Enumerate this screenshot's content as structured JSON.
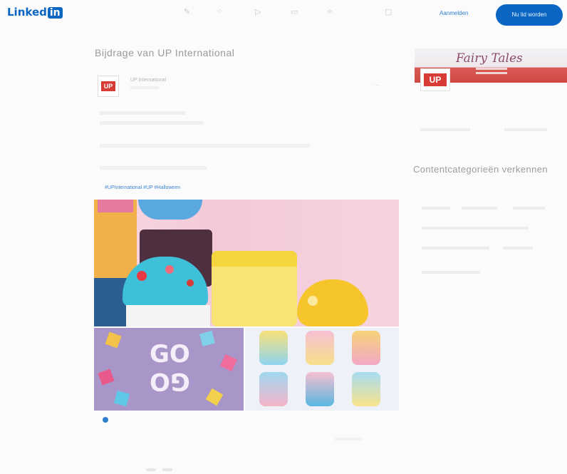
{
  "header": {
    "logo_text": "Linked",
    "logo_badge": "in",
    "sign_in_label": "Aanmelden",
    "join_label": "Nu lid worden"
  },
  "post": {
    "title": "Bijdrage van UP International",
    "author": "UP International",
    "avatar_text": "UP",
    "more_label": "...",
    "hashtag_link": "#UPInternational #UP #Halloween"
  },
  "images": {
    "go_text_top": "GO",
    "go_text_bottom": "GO"
  },
  "sidebar": {
    "banner_title": "Fairy Tales",
    "avatar_text": "UP",
    "categories_heading": "Contentcategorieën verkennen"
  },
  "colors": {
    "brand_blue": "#0a66c2",
    "up_red": "#d63b35",
    "link_blue": "#3d86d6"
  }
}
